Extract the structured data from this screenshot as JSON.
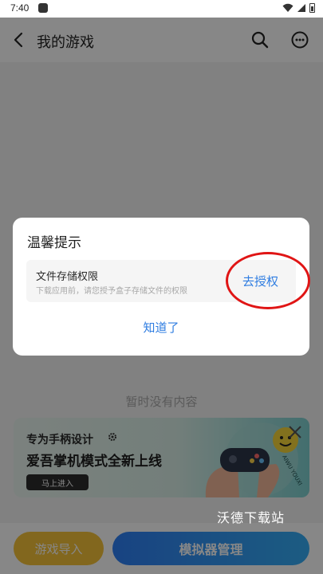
{
  "status_bar": {
    "time": "7:40"
  },
  "header": {
    "title": "我的游戏"
  },
  "content": {
    "empty_text": "暂时没有内容",
    "banner": {
      "line1": "专为手柄设计",
      "line2": "爱吾掌机模式全新上线",
      "cta": "马上进入",
      "brand_text": "AIWU YOUXI"
    }
  },
  "bottom": {
    "import_label": "游戏导入",
    "emulator_label": "模拟器管理"
  },
  "dialog": {
    "title": "温馨提示",
    "permission": {
      "name": "文件存储权限",
      "desc": "下载应用前，请您授予盒子存储文件的权限",
      "action": "去授权"
    },
    "ok_label": "知道了"
  },
  "watermark": "沃德下载站",
  "colors": {
    "accent_blue": "#2f7de1",
    "highlight_red": "#e01515",
    "import_yellow": "#f6c23a"
  }
}
